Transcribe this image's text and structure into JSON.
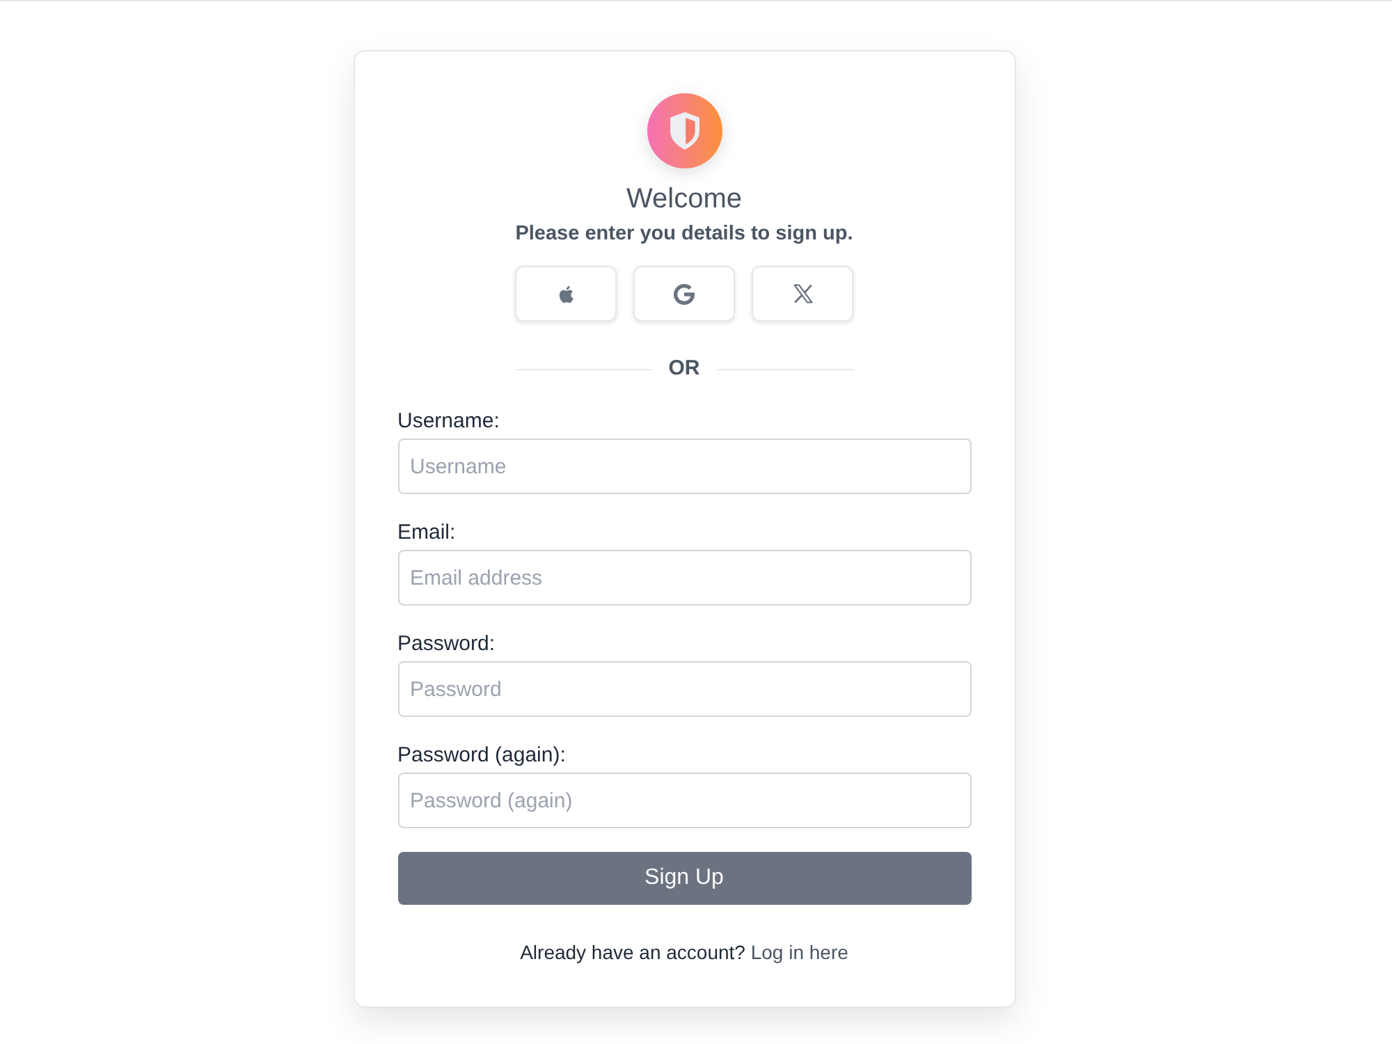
{
  "header": {
    "title": "Welcome",
    "subtitle": "Please enter you details to sign up."
  },
  "social_buttons": [
    {
      "kind": "apple"
    },
    {
      "kind": "google"
    },
    {
      "kind": "x"
    }
  ],
  "divider": {
    "label": "OR"
  },
  "fields": [
    {
      "label": "Username:",
      "placeholder": "Username"
    },
    {
      "label": "Email:",
      "placeholder": "Email address"
    },
    {
      "label": "Password:",
      "placeholder": "Password"
    },
    {
      "label": "Password (again):",
      "placeholder": "Password (again)"
    }
  ],
  "submit": {
    "label": "Sign Up"
  },
  "footer": {
    "text": "Already have an account?",
    "link": "Log in here"
  }
}
